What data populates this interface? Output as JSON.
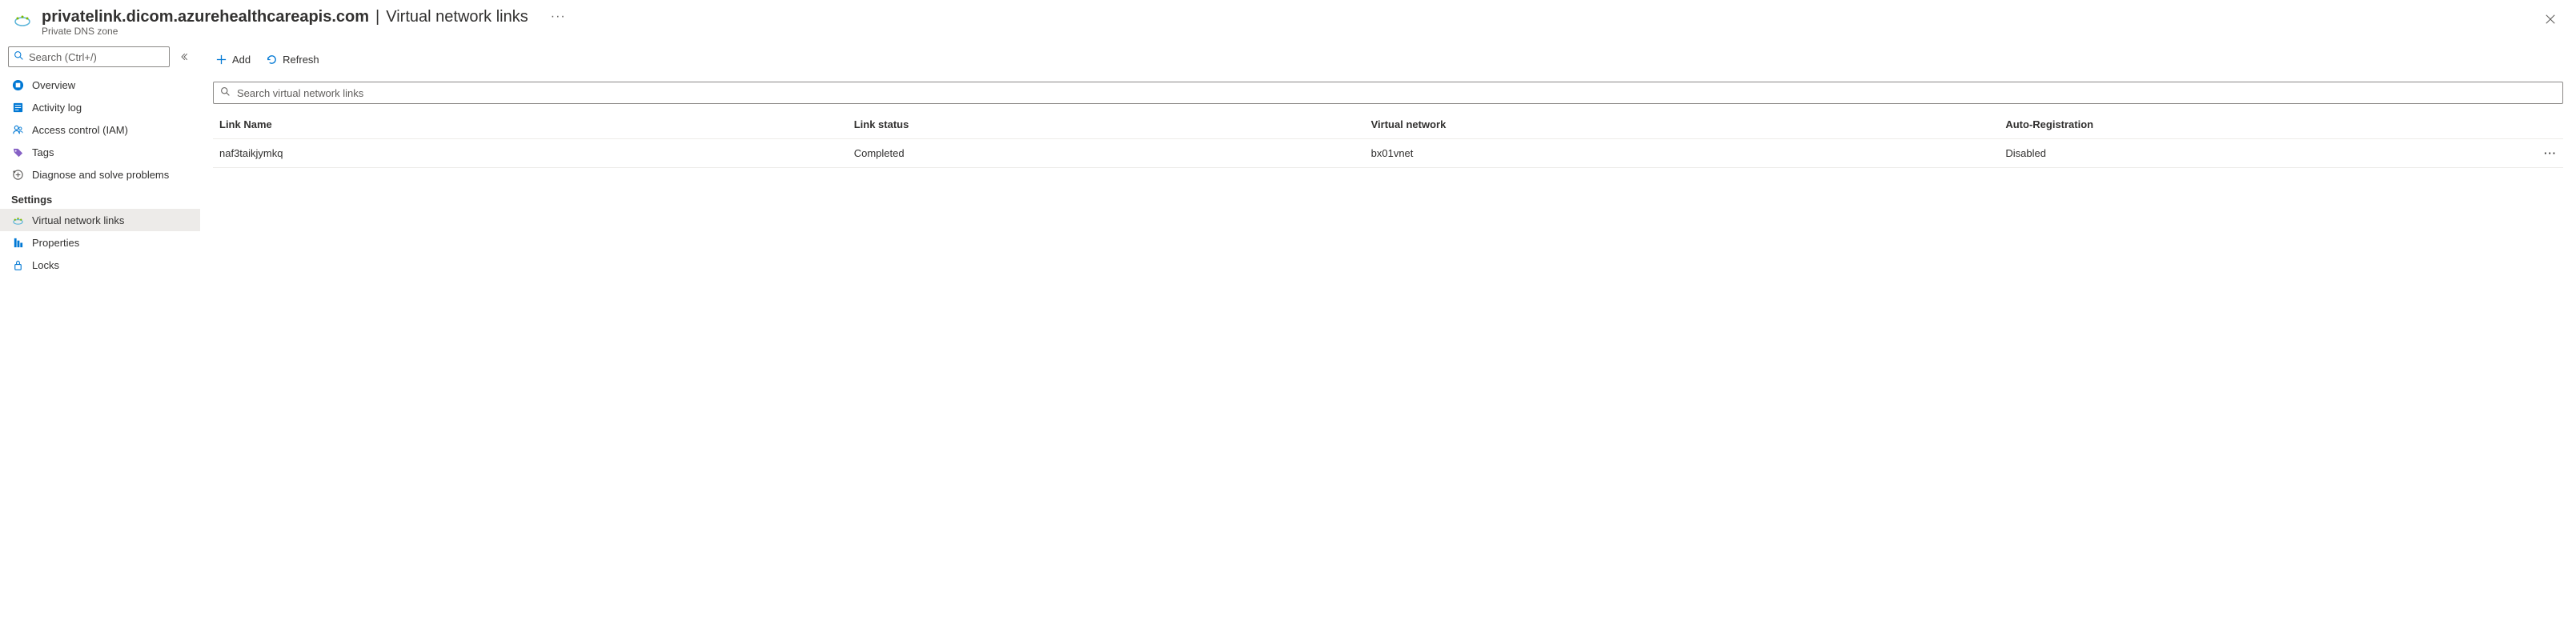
{
  "header": {
    "title": "privatelink.dicom.azurehealthcareapis.com",
    "section": "Virtual network links",
    "subtitle": "Private DNS zone"
  },
  "sidebar": {
    "search_placeholder": "Search (Ctrl+/)",
    "items": [
      {
        "label": "Overview"
      },
      {
        "label": "Activity log"
      },
      {
        "label": "Access control (IAM)"
      },
      {
        "label": "Tags"
      },
      {
        "label": "Diagnose and solve problems"
      }
    ],
    "settings_header": "Settings",
    "settings_items": [
      {
        "label": "Virtual network links"
      },
      {
        "label": "Properties"
      },
      {
        "label": "Locks"
      }
    ]
  },
  "toolbar": {
    "add_label": "Add",
    "refresh_label": "Refresh"
  },
  "main_search": {
    "placeholder": "Search virtual network links"
  },
  "table": {
    "headers": {
      "link_name": "Link Name",
      "link_status": "Link status",
      "virtual_network": "Virtual network",
      "auto_registration": "Auto-Registration"
    },
    "rows": [
      {
        "link_name": "naf3taikjymkq",
        "link_status": "Completed",
        "virtual_network": "bx01vnet",
        "auto_registration": "Disabled"
      }
    ]
  }
}
